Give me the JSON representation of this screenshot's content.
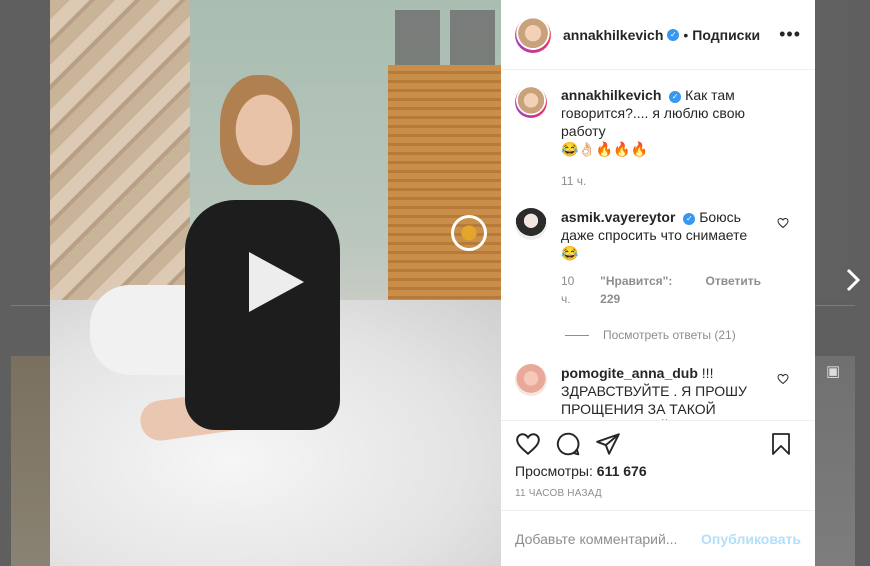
{
  "post": {
    "author": "annakhilkevich",
    "separator": "•",
    "follow_label": "Подписки",
    "caption_line1": "Как там говорится?.... я люблю свою работу",
    "caption_emoji": "😂👌🏻🔥🔥🔥",
    "caption_time": "11 ч.",
    "views_label": "Просмотры:",
    "views_count": "611 676",
    "posted_ago": "11 ЧАСОВ НАЗАД"
  },
  "comments": [
    {
      "user": "asmik.vayereytor",
      "text": "Боюсь даже спросить что снимаете 😂",
      "time": "10 ч.",
      "likes": "\"Нравится\": 229",
      "reply_label": "Ответить",
      "view_replies": "Посмотреть ответы (21)"
    },
    {
      "user": "pomogite_anna_dub",
      "text": "!!! ЗДРАВСТВУЙТЕ . Я ПРОШУ ПРОЩЕНИЯ ЗА ТАКОЙ КОММЕНТАРИЙ. ПОЛОЖЕНИЕ БЕЗВЫХОДНОЕ, ВЫНУЖДЕНА ПИСАТЬ ВЕЗДЕ, ПРОШУ ВАС О ПОМОЩИ! Я МАТЬ И МЕНЯ"
    }
  ],
  "add_comment": {
    "placeholder": "Добавьте комментарий...",
    "publish_label": "Опубликовать"
  },
  "icons": {
    "like": "heart-icon",
    "comment": "comment-icon",
    "share": "share-icon",
    "save": "bookmark-icon",
    "more": "more-options-icon",
    "next": "chevron-right-icon",
    "play": "play-icon"
  },
  "colors": {
    "verified": "#3897f0",
    "publish_disabled": "#b2dffc",
    "meta_text": "#8e8e8e"
  }
}
